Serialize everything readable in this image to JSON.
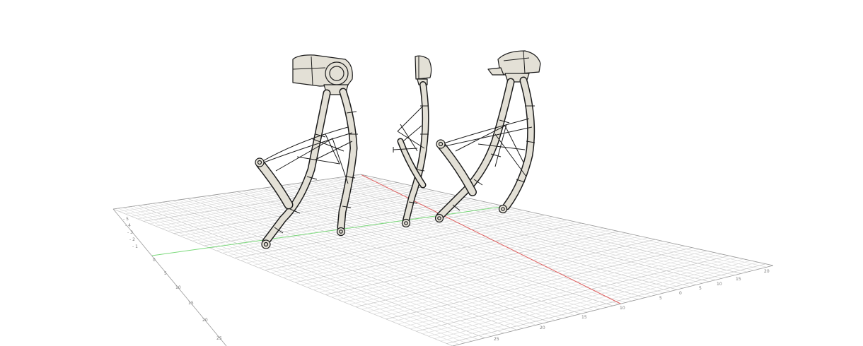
{
  "viewport": {
    "background": "#ffffff",
    "grid_color": "#d8d8d8",
    "grid_major_color": "#bcbcbc",
    "x_axis_color": "#e06060",
    "y_axis_color": "#7ad97a",
    "model_fill": "#e3e0d6",
    "model_outline": "#1c1c1c"
  },
  "grid": {
    "left_edge_ticks": [
      "- 5",
      "- 4",
      "- 3",
      "- 2",
      "- 1",
      "0",
      "5",
      "10",
      "15",
      "20",
      "25"
    ],
    "bottom_edge_ticks": [
      "25",
      "20",
      "15",
      "10",
      "5",
      "0",
      "5",
      "10",
      "15",
      "20"
    ]
  },
  "models": [
    {
      "name": "front-view"
    },
    {
      "name": "side-view"
    },
    {
      "name": "three-quarter-view"
    }
  ]
}
